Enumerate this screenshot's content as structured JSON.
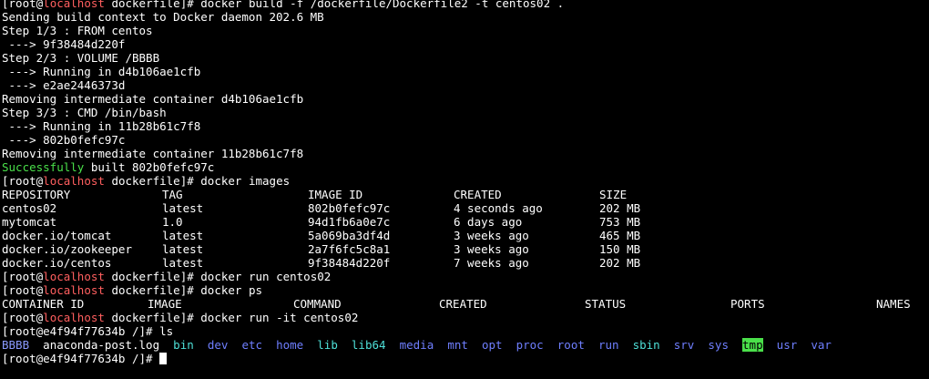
{
  "window": {
    "title": "",
    "user": "root",
    "host": "localhost",
    "cwd": "dockerfile"
  },
  "lines": [
    {
      "type": "prompt",
      "user": "root",
      "host": "localhost",
      "cwd": "dockerfile",
      "cmd": "docker build -f /dockerfile/Dockerfile2 -t centos02 ."
    },
    {
      "type": "out",
      "text": "Sending build context to Docker daemon 202.6 MB"
    },
    {
      "type": "out",
      "text": "Step 1/3 : FROM centos"
    },
    {
      "type": "out",
      "text": " ---> 9f38484d220f"
    },
    {
      "type": "out",
      "text": "Step 2/3 : VOLUME /BBBB"
    },
    {
      "type": "out",
      "text": " ---> Running in d4b106ae1cfb"
    },
    {
      "type": "out",
      "text": " ---> e2ae2446373d"
    },
    {
      "type": "out",
      "text": "Removing intermediate container d4b106ae1cfb"
    },
    {
      "type": "out",
      "text": "Step 3/3 : CMD /bin/bash"
    },
    {
      "type": "out",
      "text": " ---> Running in 11b28b61c7f8"
    },
    {
      "type": "out",
      "text": " ---> 802b0fefc97c"
    },
    {
      "type": "out",
      "text": "Removing intermediate container 11b28b61c7f8"
    },
    {
      "type": "success",
      "label": "Successfully",
      "text": " built 802b0fefc97c"
    },
    {
      "type": "prompt",
      "user": "root",
      "host": "localhost",
      "cwd": "dockerfile",
      "cmd": "docker images"
    },
    {
      "type": "row",
      "widths": [
        176,
        160,
        160,
        160,
        120
      ],
      "cells": [
        "REPOSITORY",
        "TAG",
        "IMAGE ID",
        "CREATED",
        "SIZE"
      ]
    },
    {
      "type": "row",
      "widths": [
        176,
        160,
        160,
        160,
        120
      ],
      "cells": [
        "centos02",
        "latest",
        "802b0fefc97c",
        "4 seconds ago",
        "202 MB"
      ]
    },
    {
      "type": "row",
      "widths": [
        176,
        160,
        160,
        160,
        120
      ],
      "cells": [
        "mytomcat",
        "1.0",
        "94d1fb6a0e7c",
        "6 days ago",
        "753 MB"
      ]
    },
    {
      "type": "row",
      "widths": [
        176,
        160,
        160,
        160,
        120
      ],
      "cells": [
        "docker.io/tomcat",
        "latest",
        "5a069ba3df4d",
        "3 weeks ago",
        "465 MB"
      ]
    },
    {
      "type": "row",
      "widths": [
        176,
        160,
        160,
        160,
        120
      ],
      "cells": [
        "docker.io/zookeeper",
        "latest",
        "2a7f6fc5c8a1",
        "3 weeks ago",
        "150 MB"
      ]
    },
    {
      "type": "row",
      "widths": [
        176,
        160,
        160,
        160,
        120
      ],
      "cells": [
        "docker.io/centos",
        "latest",
        "9f38484d220f",
        "7 weeks ago",
        "202 MB"
      ]
    },
    {
      "type": "prompt",
      "user": "root",
      "host": "localhost",
      "cwd": "dockerfile",
      "cmd": "docker run centos02"
    },
    {
      "type": "prompt",
      "user": "root",
      "host": "localhost",
      "cwd": "dockerfile",
      "cmd": "docker ps"
    },
    {
      "type": "row",
      "widths": [
        160,
        160,
        160,
        160,
        160,
        160,
        60
      ],
      "cells": [
        "CONTAINER ID",
        "IMAGE",
        "COMMAND",
        "CREATED",
        "STATUS",
        "PORTS",
        "NAMES"
      ]
    },
    {
      "type": "prompt",
      "user": "root",
      "host": "localhost",
      "cwd": "dockerfile",
      "cmd": "docker run -it centos02"
    },
    {
      "type": "plain",
      "text": "[root@e4f94f77634b /]# ls"
    },
    {
      "type": "ls",
      "items": [
        {
          "name": "BBBB",
          "style": "b"
        },
        {
          "name": "anaconda-post.log",
          "style": "plain"
        },
        {
          "name": "bin",
          "style": "c"
        },
        {
          "name": "dev",
          "style": "dir"
        },
        {
          "name": "etc",
          "style": "dir"
        },
        {
          "name": "home",
          "style": "dir"
        },
        {
          "name": "lib",
          "style": "c"
        },
        {
          "name": "lib64",
          "style": "c"
        },
        {
          "name": "media",
          "style": "dir"
        },
        {
          "name": "mnt",
          "style": "dir"
        },
        {
          "name": "opt",
          "style": "dir"
        },
        {
          "name": "proc",
          "style": "dir"
        },
        {
          "name": "root",
          "style": "dir"
        },
        {
          "name": "run",
          "style": "dir"
        },
        {
          "name": "sbin",
          "style": "c"
        },
        {
          "name": "srv",
          "style": "dir"
        },
        {
          "name": "sys",
          "style": "dir"
        },
        {
          "name": "tmp",
          "style": "tmp"
        },
        {
          "name": "usr",
          "style": "dir"
        },
        {
          "name": "var",
          "style": "dir"
        }
      ]
    },
    {
      "type": "plain",
      "text": "[root@e4f94f77634b /]# ",
      "cursor": true
    }
  ]
}
